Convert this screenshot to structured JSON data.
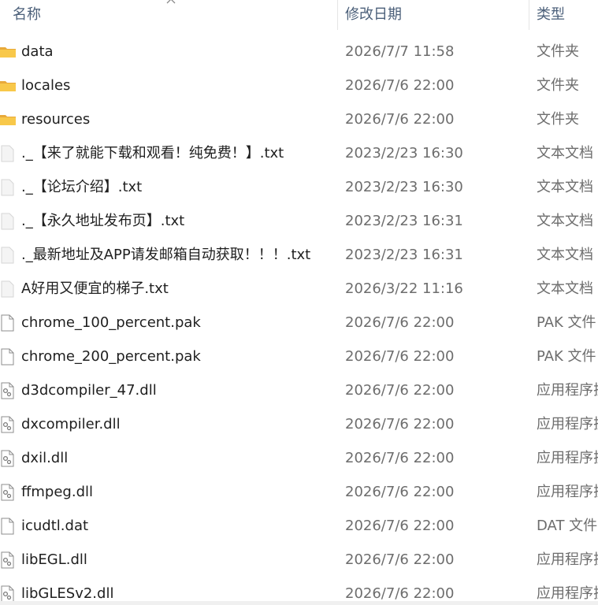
{
  "columns": {
    "name": "名称",
    "date": "修改日期",
    "type": "类型"
  },
  "files": [
    {
      "name": "data",
      "date": "2026/7/7 11:58",
      "type": "文件夹",
      "icon": "folder-icon"
    },
    {
      "name": "locales",
      "date": "2026/7/6 22:00",
      "type": "文件夹",
      "icon": "folder-icon"
    },
    {
      "name": "resources",
      "date": "2026/7/6 22:00",
      "type": "文件夹",
      "icon": "folder-icon"
    },
    {
      "name": "._【来了就能下载和观看！纯免费！】.txt",
      "date": "2023/2/23 16:30",
      "type": "文本文档",
      "icon": "text-file-icon"
    },
    {
      "name": "._【论坛介绍】.txt",
      "date": "2023/2/23 16:30",
      "type": "文本文档",
      "icon": "text-file-icon"
    },
    {
      "name": "._【永久地址发布页】.txt",
      "date": "2023/2/23 16:31",
      "type": "文本文档",
      "icon": "text-file-icon"
    },
    {
      "name": "._最新地址及APP请发邮箱自动获取！！！.txt",
      "date": "2023/2/23 16:31",
      "type": "文本文档",
      "icon": "text-file-icon"
    },
    {
      "name": "A好用又便宜的梯子.txt",
      "date": "2026/3/22 11:16",
      "type": "文本文档",
      "icon": "text-file-icon"
    },
    {
      "name": "chrome_100_percent.pak",
      "date": "2026/7/6 22:00",
      "type": "PAK 文件",
      "icon": "blank-file-icon"
    },
    {
      "name": "chrome_200_percent.pak",
      "date": "2026/7/6 22:00",
      "type": "PAK 文件",
      "icon": "blank-file-icon"
    },
    {
      "name": "d3dcompiler_47.dll",
      "date": "2026/7/6 22:00",
      "type": "应用程序扩",
      "icon": "dll-file-icon"
    },
    {
      "name": "dxcompiler.dll",
      "date": "2026/7/6 22:00",
      "type": "应用程序扩",
      "icon": "dll-file-icon"
    },
    {
      "name": "dxil.dll",
      "date": "2026/7/6 22:00",
      "type": "应用程序扩",
      "icon": "dll-file-icon"
    },
    {
      "name": "ffmpeg.dll",
      "date": "2026/7/6 22:00",
      "type": "应用程序扩",
      "icon": "dll-file-icon"
    },
    {
      "name": "icudtl.dat",
      "date": "2026/7/6 22:00",
      "type": "DAT 文件",
      "icon": "blank-file-icon"
    },
    {
      "name": "libEGL.dll",
      "date": "2026/7/6 22:00",
      "type": "应用程序扩",
      "icon": "dll-file-icon"
    },
    {
      "name": "libGLESv2.dll",
      "date": "2026/7/6 22:00",
      "type": "应用程序扩",
      "icon": "dll-file-icon"
    }
  ],
  "colors": {
    "header_text": "#4c607a",
    "name_text": "#1f1f1f",
    "meta_text": "#6d6d6d",
    "folder_yellow": "#f8c84a"
  }
}
